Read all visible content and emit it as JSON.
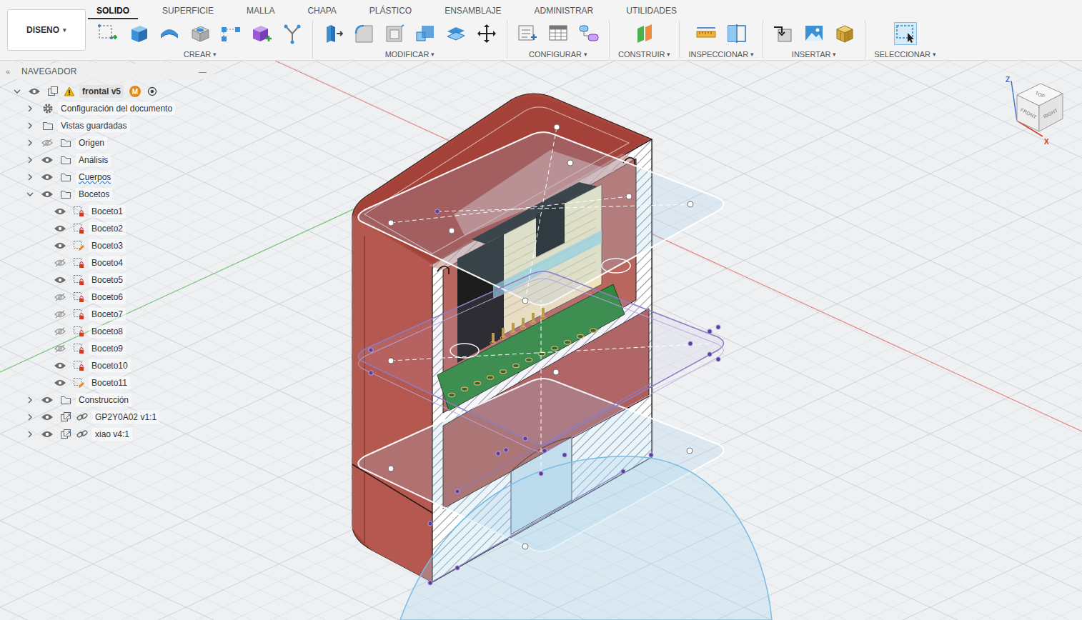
{
  "workspace": {
    "label": "DISENO",
    "caret": "▾"
  },
  "tabs": [
    {
      "label": "SOLIDO",
      "selected": true
    },
    {
      "label": "SUPERFICIE",
      "selected": false
    },
    {
      "label": "MALLA",
      "selected": false
    },
    {
      "label": "CHAPA",
      "selected": false
    },
    {
      "label": "PLÁSTICO",
      "selected": false
    },
    {
      "label": "ENSAMBLAJE",
      "selected": false
    },
    {
      "label": "ADMINISTRAR",
      "selected": false
    },
    {
      "label": "UTILIDADES",
      "selected": false
    }
  ],
  "tool_groups": [
    {
      "label": "CREAR",
      "caret": "▾",
      "active": false
    },
    {
      "label": "MODIFICAR",
      "caret": "▾",
      "active": false
    },
    {
      "label": "CONFIGURAR",
      "caret": "▾",
      "active": false
    },
    {
      "label": "CONSTRUIR",
      "caret": "▾",
      "active": false
    },
    {
      "label": "INSPECCIONAR",
      "caret": "▾",
      "active": false
    },
    {
      "label": "INSERTAR",
      "caret": "▾",
      "active": false
    },
    {
      "label": "SELECCIONAR",
      "caret": "▾",
      "active": true
    }
  ],
  "navigator": {
    "title": "NAVEGADOR",
    "collapse_icon": "«",
    "minimize_icon": "—",
    "items": [
      {
        "label": "frontal v5",
        "level": 0,
        "kind": "root",
        "expandable": true,
        "expanded": true,
        "eye": "shown",
        "warning": true,
        "underlined": false,
        "badge": "M"
      },
      {
        "label": "Configuración del documento",
        "level": 1,
        "kind": "settings",
        "expandable": true,
        "expanded": false,
        "eye": "none",
        "warning": false,
        "underlined": false
      },
      {
        "label": "Vistas guardadas",
        "level": 1,
        "kind": "folder",
        "expandable": true,
        "expanded": false,
        "eye": "none",
        "warning": false,
        "underlined": false
      },
      {
        "label": "Origen",
        "level": 1,
        "kind": "folder",
        "expandable": true,
        "expanded": false,
        "eye": "hidden",
        "warning": false,
        "underlined": false
      },
      {
        "label": "Análisis",
        "level": 1,
        "kind": "folder",
        "expandable": true,
        "expanded": false,
        "eye": "shown",
        "warning": false,
        "underlined": false
      },
      {
        "label": "Cuerpos",
        "level": 1,
        "kind": "folder",
        "expandable": true,
        "expanded": false,
        "eye": "shown",
        "warning": false,
        "underlined": true
      },
      {
        "label": "Bocetos",
        "level": 1,
        "kind": "folder",
        "expandable": true,
        "expanded": true,
        "eye": "shown",
        "warning": false,
        "underlined": false
      },
      {
        "label": "Boceto1",
        "level": 2,
        "kind": "sketch",
        "expandable": false,
        "expanded": false,
        "eye": "shown",
        "warning": false,
        "underlined": false
      },
      {
        "label": "Boceto2",
        "level": 2,
        "kind": "sketch",
        "expandable": false,
        "expanded": false,
        "eye": "shown",
        "warning": false,
        "underlined": false
      },
      {
        "label": "Boceto3",
        "level": 2,
        "kind": "sketch-edit",
        "expandable": false,
        "expanded": false,
        "eye": "shown",
        "warning": false,
        "underlined": false
      },
      {
        "label": "Boceto4",
        "level": 2,
        "kind": "sketch",
        "expandable": false,
        "expanded": false,
        "eye": "hidden",
        "warning": false,
        "underlined": false
      },
      {
        "label": "Boceto5",
        "level": 2,
        "kind": "sketch",
        "expandable": false,
        "expanded": false,
        "eye": "shown",
        "warning": false,
        "underlined": false
      },
      {
        "label": "Boceto6",
        "level": 2,
        "kind": "sketch",
        "expandable": false,
        "expanded": false,
        "eye": "hidden",
        "warning": false,
        "underlined": false
      },
      {
        "label": "Boceto7",
        "level": 2,
        "kind": "sketch",
        "expandable": false,
        "expanded": false,
        "eye": "hidden",
        "warning": false,
        "underlined": false
      },
      {
        "label": "Boceto8",
        "level": 2,
        "kind": "sketch",
        "expandable": false,
        "expanded": false,
        "eye": "hidden",
        "warning": false,
        "underlined": false
      },
      {
        "label": "Boceto9",
        "level": 2,
        "kind": "sketch",
        "expandable": false,
        "expanded": false,
        "eye": "hidden",
        "warning": false,
        "underlined": false
      },
      {
        "label": "Boceto10",
        "level": 2,
        "kind": "sketch",
        "expandable": false,
        "expanded": false,
        "eye": "shown",
        "warning": false,
        "underlined": false
      },
      {
        "label": "Boceto11",
        "level": 2,
        "kind": "sketch-edit",
        "expandable": false,
        "expanded": false,
        "eye": "shown",
        "warning": false,
        "underlined": false
      },
      {
        "label": "Construcción",
        "level": 1,
        "kind": "folder",
        "expandable": true,
        "expanded": false,
        "eye": "shown",
        "warning": false,
        "underlined": false
      },
      {
        "label": "GP2Y0A02 v1:1",
        "level": 1,
        "kind": "component-link",
        "expandable": true,
        "expanded": false,
        "eye": "shown",
        "warning": false,
        "underlined": false
      },
      {
        "label": "xiao v4:1",
        "level": 1,
        "kind": "component-link",
        "expandable": true,
        "expanded": false,
        "eye": "shown",
        "warning": false,
        "underlined": false
      }
    ]
  },
  "viewcube": {
    "top": "TOP",
    "front": "FRONT",
    "right": "RIGHT",
    "z_axis": "Z",
    "x_axis": "X"
  }
}
